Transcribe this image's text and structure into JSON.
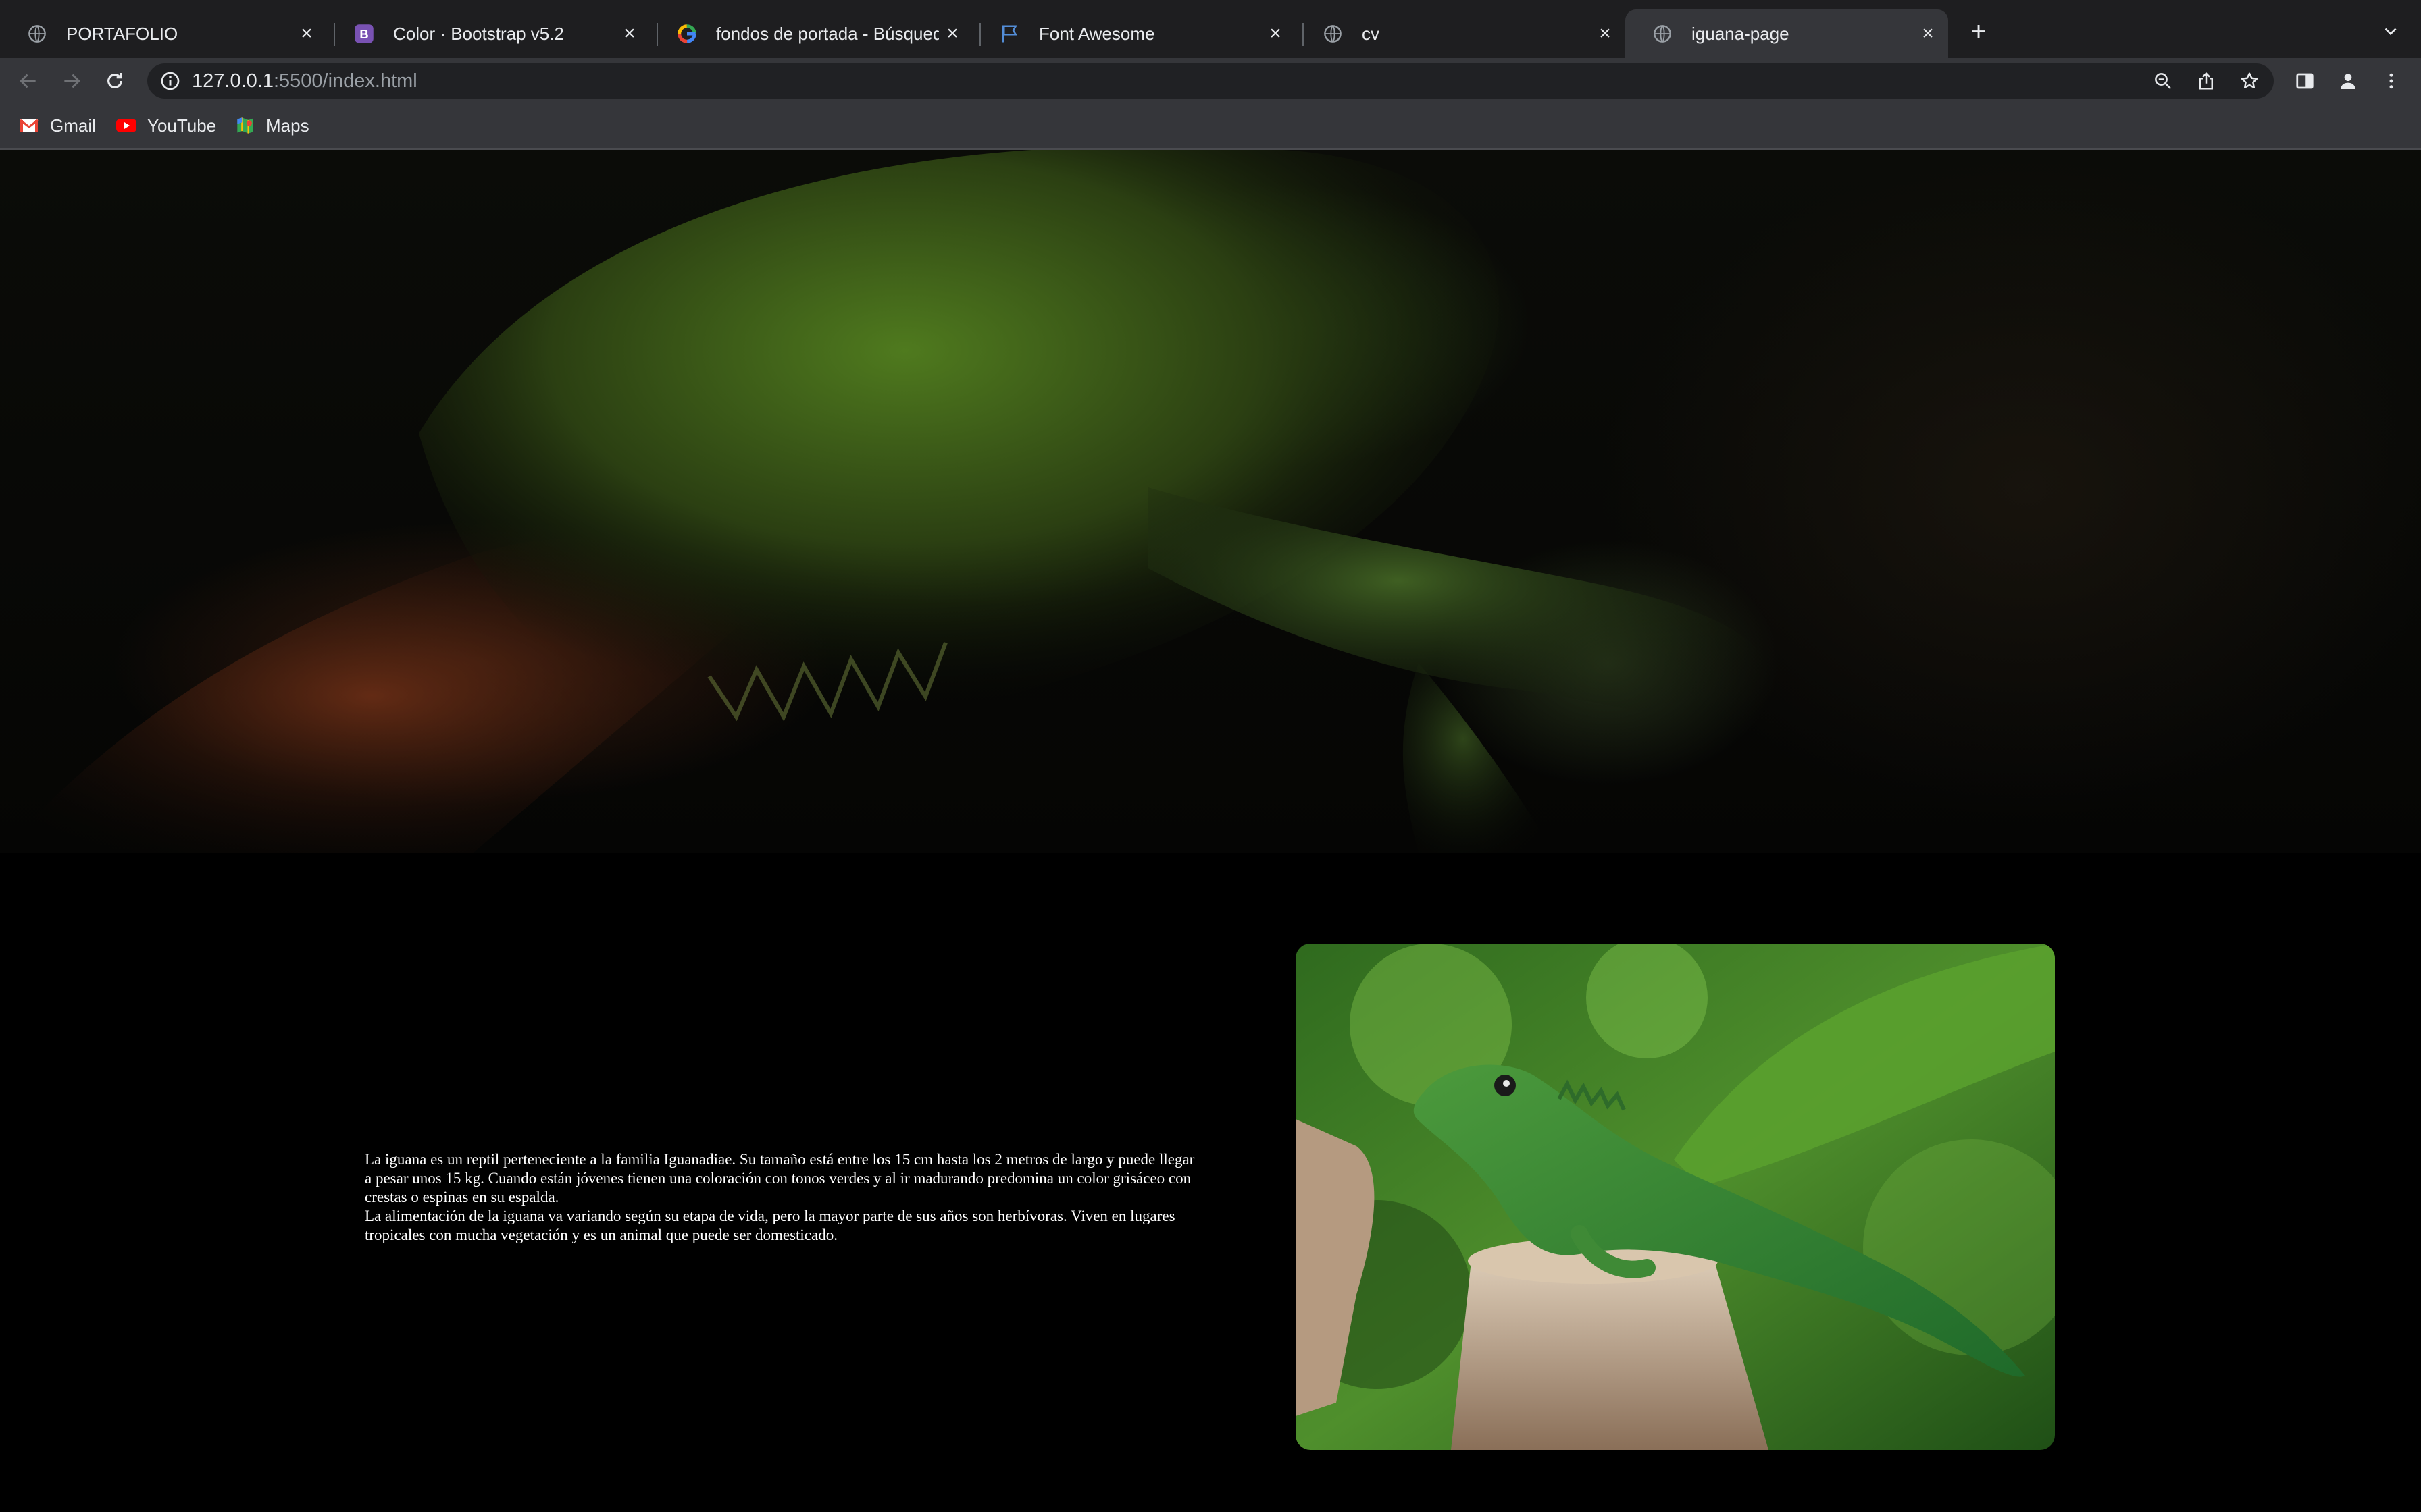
{
  "browser": {
    "tabs": [
      {
        "title": "PORTAFOLIO",
        "icon": "globe-icon",
        "active": false
      },
      {
        "title": "Color · Bootstrap v5.2",
        "icon": "bootstrap-icon",
        "active": false
      },
      {
        "title": "fondos de portada - Búsqueda",
        "icon": "google-icon",
        "active": false
      },
      {
        "title": "Font Awesome",
        "icon": "flag-icon",
        "active": false
      },
      {
        "title": "cv",
        "icon": "globe-icon",
        "active": false
      },
      {
        "title": "iguana-page",
        "icon": "globe-icon",
        "active": true
      }
    ],
    "url": {
      "host": "127.0.0.1",
      "path": ":5500/index.html"
    },
    "bookmarks": [
      {
        "label": "Gmail",
        "icon": "gmail-icon"
      },
      {
        "label": "YouTube",
        "icon": "youtube-icon"
      },
      {
        "label": "Maps",
        "icon": "maps-icon"
      }
    ]
  },
  "page": {
    "intro": {
      "paragraph1": "La iguana es un reptil perteneciente a la familia Iguanadiae. Su tamaño está entre los 15 cm hasta los 2 metros de largo y puede llegar a pesar unos 15 kg. Cuando están jóvenes tienen una coloración con tonos verdes y al ir madurando predomina un color grisáceo con crestas o espinas en su espalda.",
      "paragraph2": "La alimentación de la iguana va variando según su etapa de vida, pero la mayor parte de sus años son herbívoras. Viven en lugares tropicales con mucha vegetación y es un animal que puede ser domesticado."
    }
  },
  "colors": {
    "tabstrip": "#1e1e20",
    "toolbar": "#35363a",
    "page_background": "#000000",
    "text": "#ffffff"
  }
}
